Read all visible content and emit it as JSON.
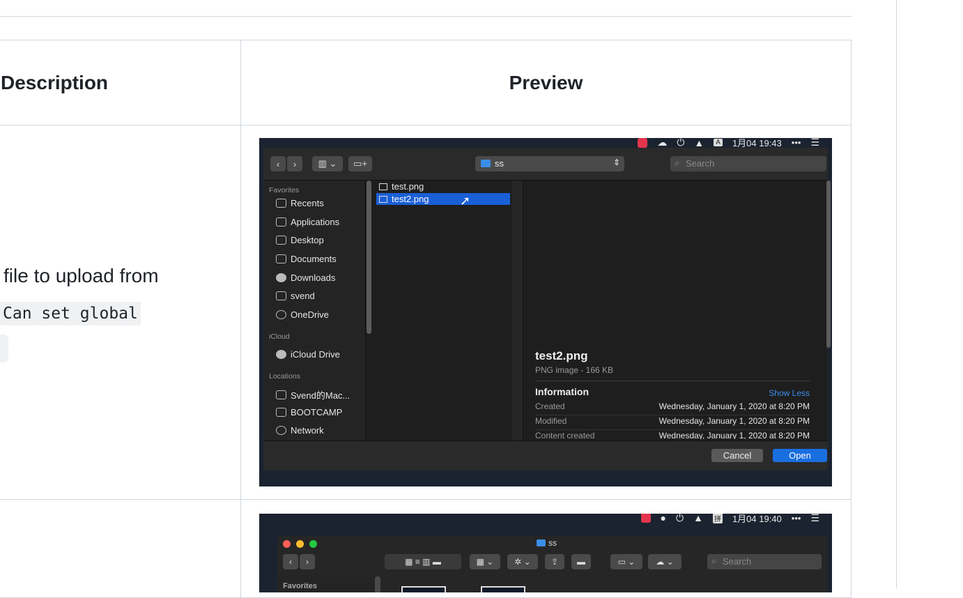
{
  "table": {
    "headers": [
      "Description",
      "Preview"
    ],
    "row1": {
      "description": "file to upload from",
      "code": "Can set global"
    }
  },
  "open_dialog": {
    "menubar": {
      "keyboard_label": "A",
      "clock": "1月04 19:43",
      "more": "•••"
    },
    "path": "ss",
    "search_placeholder": "Search",
    "sidebar": {
      "favorites_header": "Favorites",
      "favorites": [
        "Recents",
        "Applications",
        "Desktop",
        "Documents",
        "Downloads",
        "svend",
        "OneDrive"
      ],
      "icloud_header": "iCloud",
      "icloud": [
        "iCloud Drive"
      ],
      "locations_header": "Locations",
      "locations": [
        "Svend的Mac...",
        "BOOTCAMP",
        "Network"
      ]
    },
    "files": [
      "test.png",
      "test2.png"
    ],
    "preview": {
      "name": "test2.png",
      "type": "PNG image - 166 KB",
      "info_label": "Information",
      "show_less": "Show Less",
      "rows": [
        {
          "label": "Created",
          "value": "Wednesday, January 1, 2020 at 8:20 PM"
        },
        {
          "label": "Modified",
          "value": "Wednesday, January 1, 2020 at 8:20 PM"
        },
        {
          "label": "Content created",
          "value": "Wednesday, January 1, 2020 at 8:20 PM"
        }
      ]
    },
    "cancel_label": "Cancel",
    "open_label": "Open"
  },
  "finder": {
    "menubar": {
      "keyboard_label": "拼",
      "clock": "1月04 19:40",
      "more": "•••"
    },
    "title": "ss",
    "search_placeholder": "Search",
    "favorites_header": "Favorites"
  },
  "colors": {
    "selection": "#1a5fd6",
    "open_button": "#1a6fe0",
    "link": "#3d8ff0",
    "desktop": "#1b2330"
  }
}
